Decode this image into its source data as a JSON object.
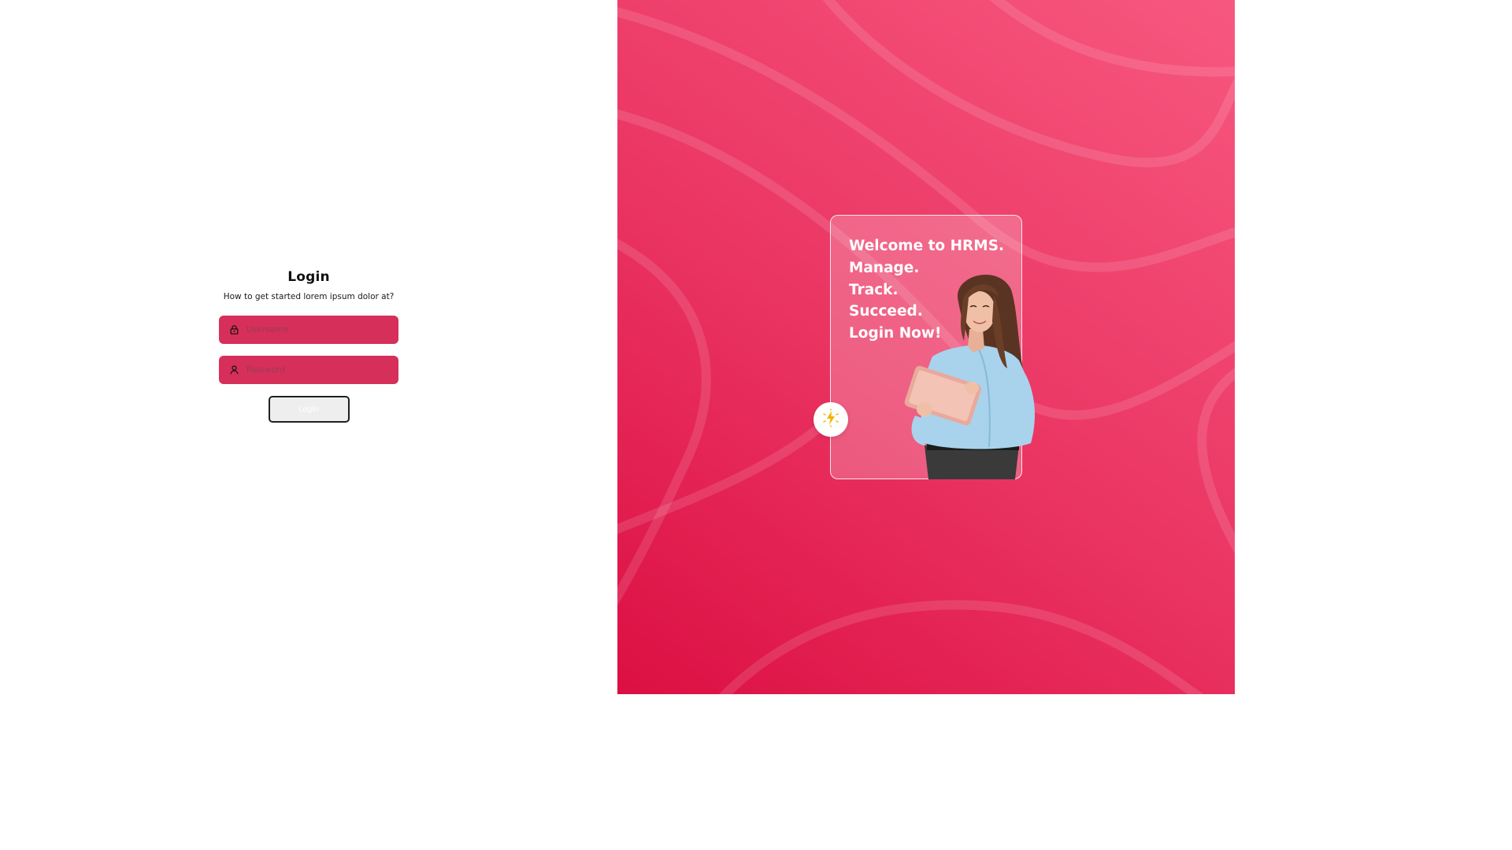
{
  "login": {
    "title": "Login",
    "subtitle": "How to get started lorem ipsum dolor at?",
    "username_placeholder": "Username",
    "password_placeholder": "Password",
    "button_label": "Login",
    "username_icon": "lock-icon",
    "password_icon": "user-icon"
  },
  "welcome": {
    "lines": [
      "Welcome to HRMS.",
      "Manage.",
      "Track.",
      "Succeed.",
      "Login Now!"
    ],
    "badge_icon": "sparkle-icon"
  },
  "colors": {
    "accent": "#d62f5a",
    "gradient_dark": "#dc0f43",
    "gradient_light": "#f7587f",
    "sparkle": "#f0b400"
  }
}
